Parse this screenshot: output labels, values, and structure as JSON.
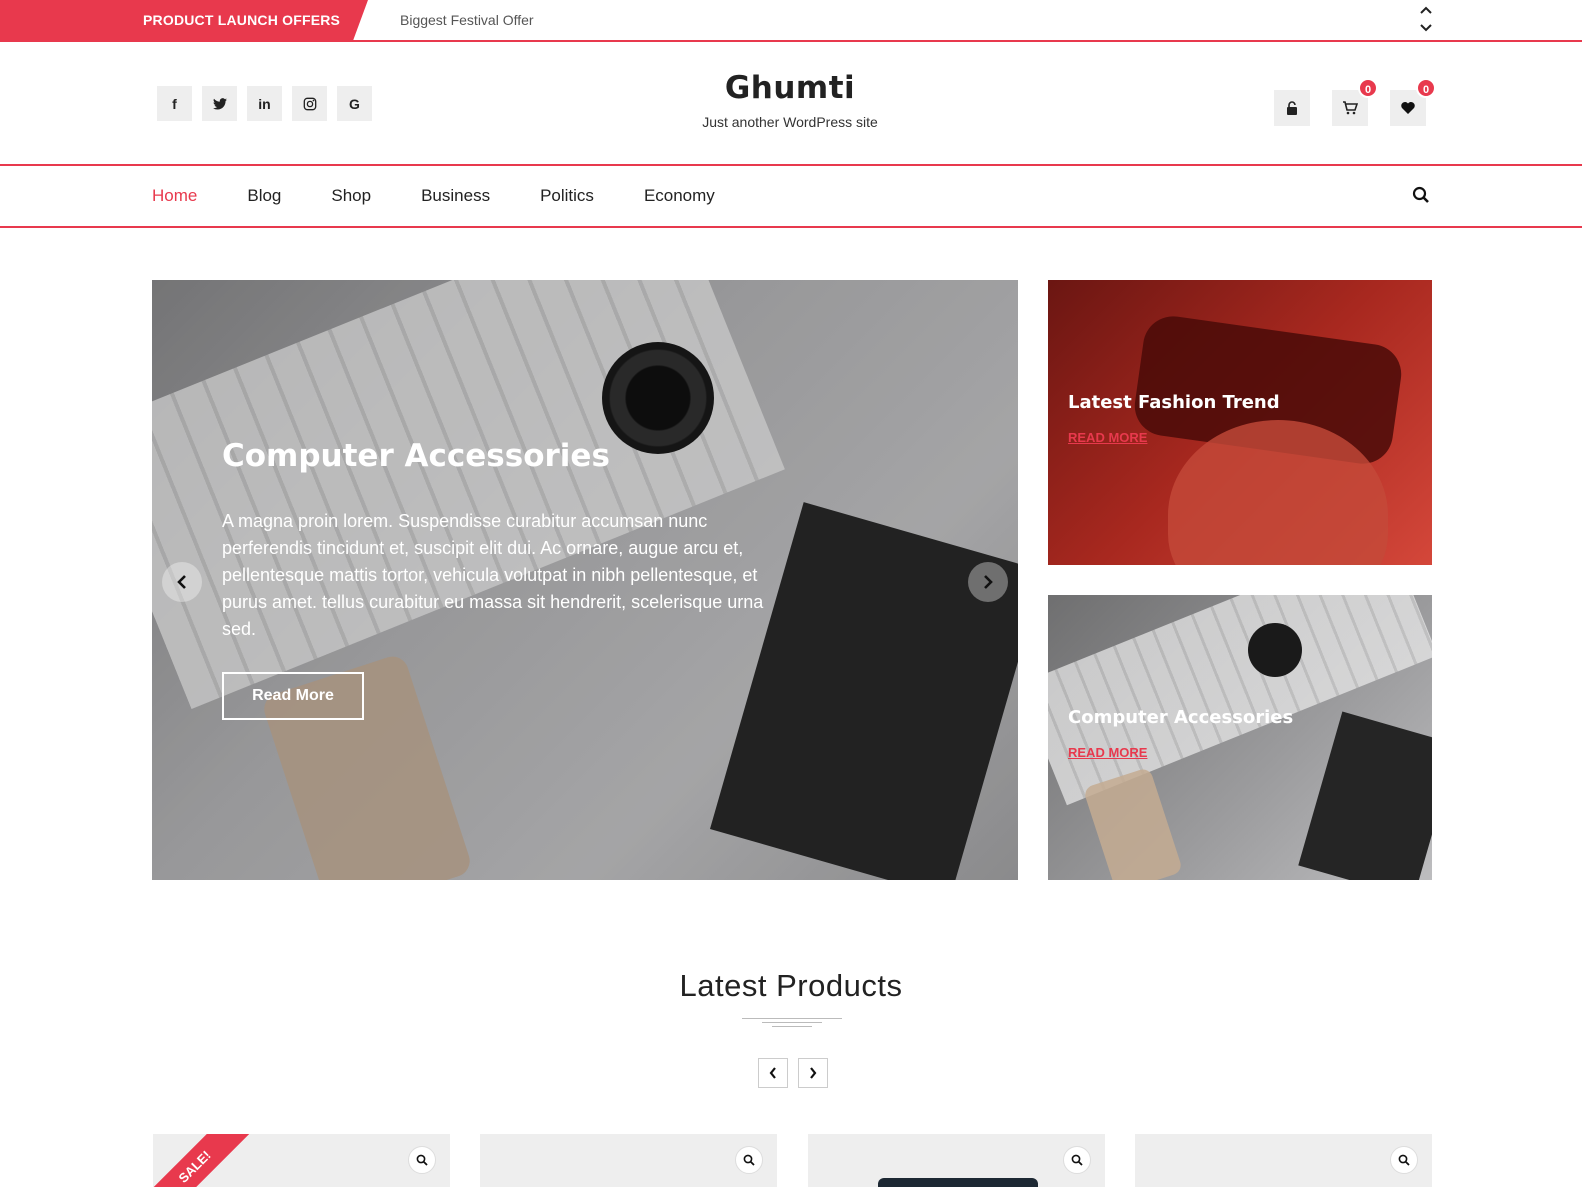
{
  "topbar": {
    "promo_label": "PRODUCT LAUNCH OFFERS",
    "promo_text": "Biggest Festival Offer"
  },
  "header": {
    "title": "Ghumti",
    "tagline": "Just another WordPress site",
    "social": [
      "f",
      "t",
      "in",
      "ig",
      "G"
    ],
    "cart_count": "0",
    "wishlist_count": "0"
  },
  "nav": {
    "items": [
      "Home",
      "Blog",
      "Shop",
      "Business",
      "Politics",
      "Economy"
    ],
    "active": "Home"
  },
  "hero": {
    "title": "Computer Accessories",
    "description": "A magna proin lorem. Suspendisse curabitur accumsan nunc perferendis tincidunt et, suscipit elit dui. Ac ornare, augue arcu et, pellentesque mattis tortor, vehicula volutpat in nibh pellentesque, et purus amet. tellus curabitur eu massa sit hendrerit, scelerisque urna sed.",
    "button": "Read More"
  },
  "side_cards": [
    {
      "title": "Latest Fashion Trend",
      "link": "READ MORE"
    },
    {
      "title": "Computer Accessories",
      "link": "READ MORE"
    }
  ],
  "products": {
    "title": "Latest Products",
    "sale_badge": "SALE!"
  },
  "colors": {
    "accent": "#e8394d",
    "text": "#222222",
    "tile_bg": "#eeeeee"
  },
  "icons": {
    "ticker_up": "chevron-up-icon",
    "ticker_down": "chevron-down-icon",
    "login": "lock-icon",
    "cart": "cart-icon",
    "wishlist": "heart-icon",
    "search": "search-icon",
    "slider_prev": "chevron-left-icon",
    "slider_next": "chevron-right-icon",
    "quick_view": "search-icon"
  }
}
